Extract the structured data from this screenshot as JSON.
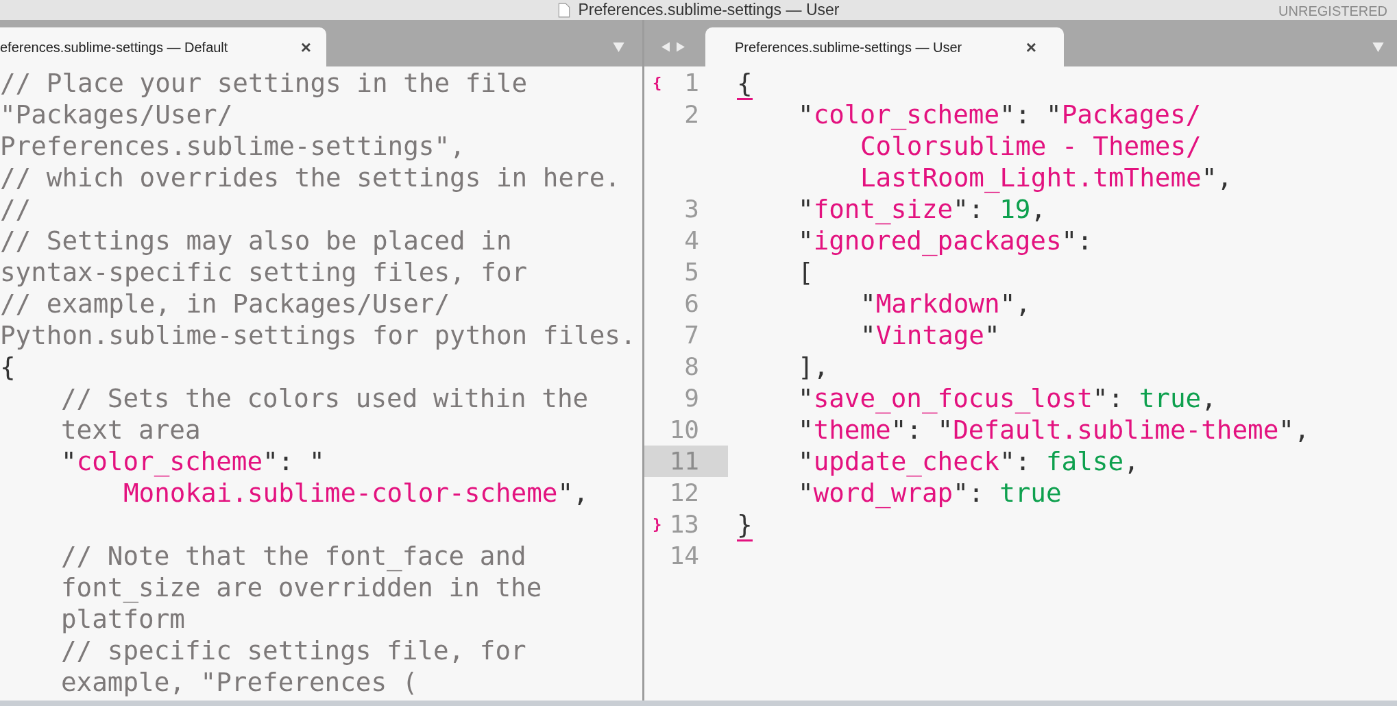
{
  "window": {
    "title": "Preferences.sublime-settings — User",
    "badge": "UNREGISTERED"
  },
  "left_pane": {
    "tabs": [
      {
        "label": "eferences.sublime-settings — Default",
        "selected": true,
        "close": "×"
      }
    ],
    "rows": [
      {
        "kind": "flush",
        "tokens": [
          {
            "kind": "comment",
            "text": "// Place your settings in the file"
          }
        ]
      },
      {
        "kind": "flush",
        "tokens": [
          {
            "kind": "comment",
            "text": "\"Packages/User/"
          }
        ]
      },
      {
        "kind": "flush",
        "tokens": [
          {
            "kind": "comment",
            "text": "Preferences.sublime-settings\","
          }
        ]
      },
      {
        "kind": "flush",
        "tokens": [
          {
            "kind": "comment",
            "text": "// which overrides the settings in here."
          }
        ]
      },
      {
        "kind": "flush",
        "tokens": [
          {
            "kind": "comment",
            "text": "//"
          }
        ]
      },
      {
        "kind": "flush",
        "tokens": [
          {
            "kind": "comment",
            "text": "// Settings may also be placed in"
          }
        ]
      },
      {
        "kind": "flush",
        "tokens": [
          {
            "kind": "comment",
            "text": "syntax-specific setting files, for"
          }
        ]
      },
      {
        "kind": "flush",
        "tokens": [
          {
            "kind": "comment",
            "text": "// example, in Packages/User/"
          }
        ]
      },
      {
        "kind": "flush",
        "tokens": [
          {
            "kind": "comment",
            "text": "Python.sublime-settings for python files."
          }
        ]
      },
      {
        "kind": "flush",
        "tokens": [
          {
            "kind": "punct",
            "text": "{"
          }
        ]
      },
      {
        "kind": "indent",
        "tokens": [
          {
            "kind": "comment",
            "text": "// Sets the colors used within the"
          }
        ]
      },
      {
        "kind": "indent",
        "tokens": [
          {
            "kind": "comment",
            "text": "text area"
          }
        ]
      },
      {
        "kind": "indent",
        "tokens": [
          {
            "kind": "punct",
            "text": "\""
          },
          {
            "kind": "string",
            "text": "color_scheme"
          },
          {
            "kind": "punct",
            "text": "\": \""
          }
        ]
      },
      {
        "kind": "hang",
        "tokens": [
          {
            "kind": "string",
            "text": "Monokai.sublime-color-scheme"
          },
          {
            "kind": "punct",
            "text": "\","
          }
        ]
      },
      {
        "kind": "blank"
      },
      {
        "kind": "indent",
        "tokens": [
          {
            "kind": "comment",
            "text": "// Note that the font_face and"
          }
        ]
      },
      {
        "kind": "indent",
        "tokens": [
          {
            "kind": "comment",
            "text": "font_size are overridden in the"
          }
        ]
      },
      {
        "kind": "indent",
        "tokens": [
          {
            "kind": "comment",
            "text": "platform"
          }
        ]
      },
      {
        "kind": "indent",
        "tokens": [
          {
            "kind": "comment",
            "text": "// specific settings file, for"
          }
        ]
      },
      {
        "kind": "indent",
        "tokens": [
          {
            "kind": "comment",
            "text": "example, \"Preferences ("
          }
        ]
      }
    ]
  },
  "right_pane": {
    "tabs": [
      {
        "label": "Preferences.sublime-settings — User",
        "selected": true,
        "close": "×"
      }
    ],
    "lines": [
      {
        "number": "1",
        "fold": "{",
        "selected": false,
        "rows": [
          {
            "kind": "flush",
            "tokens": [
              {
                "kind": "bracket",
                "text": "{"
              }
            ]
          }
        ]
      },
      {
        "number": "2",
        "selected": false,
        "rows": [
          {
            "kind": "indent",
            "tokens": [
              {
                "kind": "punct",
                "text": "\""
              },
              {
                "kind": "string",
                "text": "color_scheme"
              },
              {
                "kind": "punct",
                "text": "\": \""
              },
              {
                "kind": "string",
                "text": "Packages/"
              }
            ]
          },
          {
            "kind": "hang",
            "tokens": [
              {
                "kind": "string",
                "text": "Colorsublime - Themes/"
              }
            ]
          },
          {
            "kind": "hang",
            "tokens": [
              {
                "kind": "string",
                "text": "LastRoom_Light.tmTheme"
              },
              {
                "kind": "punct",
                "text": "\","
              }
            ]
          }
        ]
      },
      {
        "number": "3",
        "selected": false,
        "rows": [
          {
            "kind": "indent",
            "tokens": [
              {
                "kind": "punct",
                "text": "\""
              },
              {
                "kind": "string",
                "text": "font_size"
              },
              {
                "kind": "punct",
                "text": "\": "
              },
              {
                "kind": "value",
                "text": "19"
              },
              {
                "kind": "punct",
                "text": ","
              }
            ]
          }
        ]
      },
      {
        "number": "4",
        "selected": false,
        "rows": [
          {
            "kind": "indent",
            "tokens": [
              {
                "kind": "punct",
                "text": "\""
              },
              {
                "kind": "string",
                "text": "ignored_packages"
              },
              {
                "kind": "punct",
                "text": "\":"
              }
            ]
          }
        ]
      },
      {
        "number": "5",
        "selected": false,
        "rows": [
          {
            "kind": "indent",
            "tokens": [
              {
                "kind": "punct",
                "text": "["
              }
            ]
          }
        ]
      },
      {
        "number": "6",
        "selected": false,
        "rows": [
          {
            "kind": "hang",
            "tokens": [
              {
                "kind": "punct",
                "text": "\""
              },
              {
                "kind": "string",
                "text": "Markdown"
              },
              {
                "kind": "punct",
                "text": "\","
              }
            ]
          }
        ]
      },
      {
        "number": "7",
        "selected": false,
        "rows": [
          {
            "kind": "hang",
            "tokens": [
              {
                "kind": "punct",
                "text": "\""
              },
              {
                "kind": "string",
                "text": "Vintage"
              },
              {
                "kind": "punct",
                "text": "\""
              }
            ]
          }
        ]
      },
      {
        "number": "8",
        "selected": false,
        "rows": [
          {
            "kind": "indent",
            "tokens": [
              {
                "kind": "punct",
                "text": "],"
              }
            ]
          }
        ]
      },
      {
        "number": "9",
        "selected": false,
        "rows": [
          {
            "kind": "indent",
            "tokens": [
              {
                "kind": "punct",
                "text": "\""
              },
              {
                "kind": "string",
                "text": "save_on_focus_lost"
              },
              {
                "kind": "punct",
                "text": "\": "
              },
              {
                "kind": "value",
                "text": "true"
              },
              {
                "kind": "punct",
                "text": ","
              }
            ]
          }
        ]
      },
      {
        "number": "10",
        "selected": false,
        "rows": [
          {
            "kind": "indent",
            "tokens": [
              {
                "kind": "punct",
                "text": "\""
              },
              {
                "kind": "string",
                "text": "theme"
              },
              {
                "kind": "punct",
                "text": "\": \""
              },
              {
                "kind": "string",
                "text": "Default.sublime-theme"
              },
              {
                "kind": "punct",
                "text": "\","
              }
            ]
          }
        ]
      },
      {
        "number": "11",
        "selected": true,
        "rows": [
          {
            "kind": "indent",
            "tokens": [
              {
                "kind": "punct",
                "text": "\""
              },
              {
                "kind": "string",
                "text": "update_check"
              },
              {
                "kind": "punct",
                "text": "\": "
              },
              {
                "kind": "value",
                "text": "false"
              },
              {
                "kind": "punct",
                "text": ","
              }
            ]
          }
        ]
      },
      {
        "number": "12",
        "selected": false,
        "rows": [
          {
            "kind": "indent",
            "tokens": [
              {
                "kind": "punct",
                "text": "\""
              },
              {
                "kind": "string",
                "text": "word_wrap"
              },
              {
                "kind": "punct",
                "text": "\": "
              },
              {
                "kind": "value",
                "text": "true"
              }
            ]
          }
        ]
      },
      {
        "number": "13",
        "fold": "}",
        "selected": false,
        "rows": [
          {
            "kind": "flush",
            "tokens": [
              {
                "kind": "bracket",
                "text": "}"
              }
            ]
          }
        ]
      },
      {
        "number": "14",
        "selected": false,
        "rows": [
          {
            "kind": "blank"
          }
        ]
      }
    ]
  }
}
